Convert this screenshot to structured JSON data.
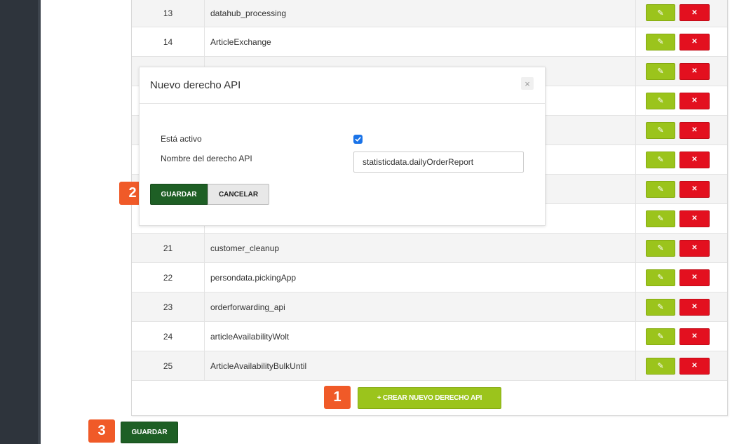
{
  "rows": [
    {
      "id": "13",
      "name": "datahub_processing"
    },
    {
      "id": "14",
      "name": "ArticleExchange"
    },
    {
      "id": "",
      "name": ""
    },
    {
      "id": "",
      "name": ""
    },
    {
      "id": "",
      "name": ""
    },
    {
      "id": "",
      "name": ""
    },
    {
      "id": "",
      "name": ""
    },
    {
      "id": "",
      "name": ""
    },
    {
      "id": "21",
      "name": "customer_cleanup"
    },
    {
      "id": "22",
      "name": "persondata.pickingApp"
    },
    {
      "id": "23",
      "name": "orderforwarding_api"
    },
    {
      "id": "24",
      "name": "articleAvailabilityWolt"
    },
    {
      "id": "25",
      "name": "ArticleAvailabilityBulkUntil"
    }
  ],
  "actions": {
    "edit_icon": "pencil-icon",
    "delete_icon": "close-icon",
    "edit_symbol": "✎",
    "delete_symbol": "✕"
  },
  "create_button": "+ CREAR NUEVO DERECHO API",
  "save_button": "GUARDAR",
  "modal": {
    "title": "Nuevo derecho API",
    "close_symbol": "×",
    "active_label": "Está activo",
    "active_checked": true,
    "name_label": "Nombre del derecho API",
    "name_value": "statisticdata.dailyOrderReport",
    "save_label": "GUARDAR",
    "cancel_label": "CANCELAR"
  },
  "badges": {
    "one": "1",
    "two": "2",
    "three": "3"
  },
  "colors": {
    "accent_green": "#9bc41c",
    "dark_green": "#1e5f25",
    "danger_red": "#e3101f",
    "badge_orange": "#f05a28",
    "sidebar": "#2e343c"
  }
}
